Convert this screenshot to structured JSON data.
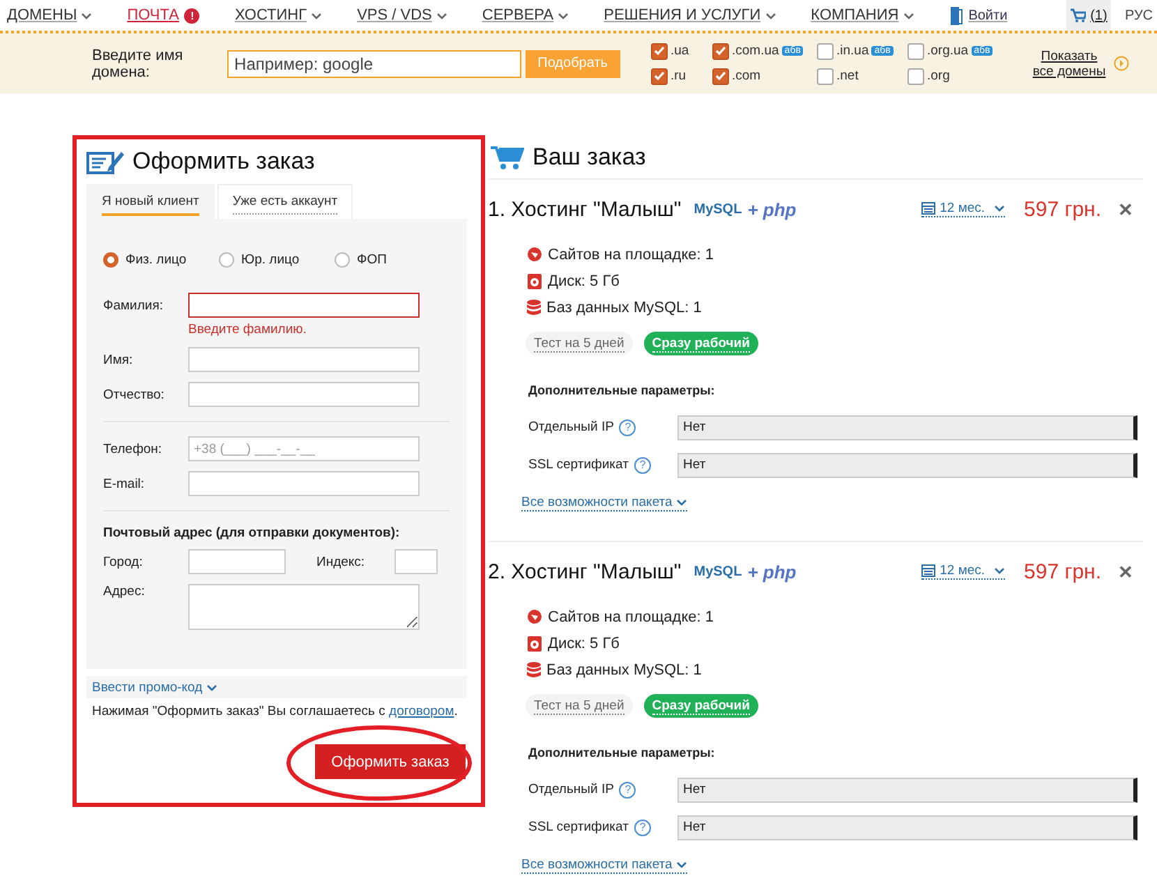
{
  "nav": {
    "items": [
      {
        "label": "ДОМЕНЫ",
        "kind": "dropdown"
      },
      {
        "label": "ПОЧТА",
        "kind": "alert",
        "badge": "!"
      },
      {
        "label": "ХОСТИНГ",
        "kind": "dropdown"
      },
      {
        "label": "VPS / VDS",
        "kind": "dropdown"
      },
      {
        "label": "СЕРВЕРА",
        "kind": "dropdown"
      },
      {
        "label": "РЕШЕНИЯ И УСЛУГИ",
        "kind": "dropdown"
      },
      {
        "label": "КОМПАНИЯ",
        "kind": "dropdown"
      }
    ],
    "login": "Войти",
    "cart_count": "(1)",
    "language": "РУС"
  },
  "domain_search": {
    "label": "Введите имя домена:",
    "placeholder": "Например: google",
    "button": "Подобрать",
    "zones": [
      {
        "label": ".ua",
        "checked": true
      },
      {
        "label": ".com.ua",
        "checked": true,
        "badge": "абв"
      },
      {
        "label": ".in.ua",
        "checked": false,
        "badge": "абв"
      },
      {
        "label": ".org.ua",
        "checked": false,
        "badge": "абв"
      },
      {
        "label": ".ru",
        "checked": true
      },
      {
        "label": ".com",
        "checked": true
      },
      {
        "label": ".net",
        "checked": false
      },
      {
        "label": ".org",
        "checked": false
      }
    ],
    "show_all": "Показать все домены"
  },
  "order_form": {
    "highlighted": true,
    "title": "Оформить заказ",
    "tabs": [
      {
        "label": "Я новый клиент",
        "selected": true
      },
      {
        "label": "Уже есть аккаунт",
        "selected": false
      }
    ],
    "person_types": [
      {
        "label": "Физ. лицо",
        "selected": true
      },
      {
        "label": "Юр. лицо",
        "selected": false
      },
      {
        "label": "ФОП",
        "selected": false
      }
    ],
    "name_fields": [
      {
        "label": "Фамилия:",
        "invalid": true,
        "error": "Введите фамилию."
      },
      {
        "label": "Имя:",
        "invalid": false
      },
      {
        "label": "Отчество:",
        "invalid": false
      }
    ],
    "contact_fields": [
      {
        "label": "Телефон:",
        "invalid": false,
        "placeholder": "+38 (___) ___-__-__"
      },
      {
        "label": "E-mail:",
        "invalid": false
      }
    ],
    "postal": {
      "title": "Почтовый адрес (для отправки документов):",
      "city_label": "Город:",
      "index_label": "Индекс:",
      "address_label": "Адрес:"
    },
    "promo_link": "Ввести промо-код",
    "agreement": {
      "text": "Нажимая \"Оформить заказ\" Вы соглашаетесь с ",
      "link": "договором",
      "end": "."
    },
    "submit": {
      "label": "Оформить заказ",
      "circled": true
    }
  },
  "order": {
    "title": "Ваш заказ",
    "items": [
      {
        "title": "1. Хостинг \"Малыш\"",
        "logo_mysql": "MySQL",
        "logo_php": "+ php",
        "period": "12 мес.",
        "price": "597 грн.",
        "remove": "✕",
        "features": [
          {
            "kind": "sites",
            "text": "Сайтов на площадке: 1"
          },
          {
            "kind": "disk",
            "text": "Диск: 5 Гб"
          },
          {
            "kind": "database",
            "text": "Баз данных MySQL: 1"
          }
        ],
        "modes": [
          {
            "label": "Тест на 5 дней",
            "selected": false
          },
          {
            "label": "Сразу рабочий",
            "selected": true
          }
        ],
        "extras_title": "Дополнительные параметры:",
        "options": [
          {
            "label": "Отдельный IP",
            "help": "?",
            "value": "Нет"
          },
          {
            "label": "SSL сертификат",
            "help": "?",
            "value": "Нет"
          }
        ],
        "more_link": "Все возможности пакета"
      },
      {
        "title": "2. Хостинг \"Малыш\"",
        "logo_mysql": "MySQL",
        "logo_php": "+ php",
        "period": "12 мес.",
        "price": "597 грн.",
        "remove": "✕",
        "features": [
          {
            "kind": "sites",
            "text": "Сайтов на площадке: 1"
          },
          {
            "kind": "disk",
            "text": "Диск: 5 Гб"
          },
          {
            "kind": "database",
            "text": "Баз данных MySQL: 1"
          }
        ],
        "modes": [
          {
            "label": "Тест на 5 дней",
            "selected": false
          },
          {
            "label": "Сразу рабочий",
            "selected": true
          }
        ],
        "extras_title": "Дополнительные параметры:",
        "options": [
          {
            "label": "Отдельный IP",
            "help": "?",
            "value": "Нет"
          },
          {
            "label": "SSL сертификат",
            "help": "?",
            "value": "Нет"
          }
        ],
        "more_link": "Все возможности пакета"
      }
    ]
  }
}
